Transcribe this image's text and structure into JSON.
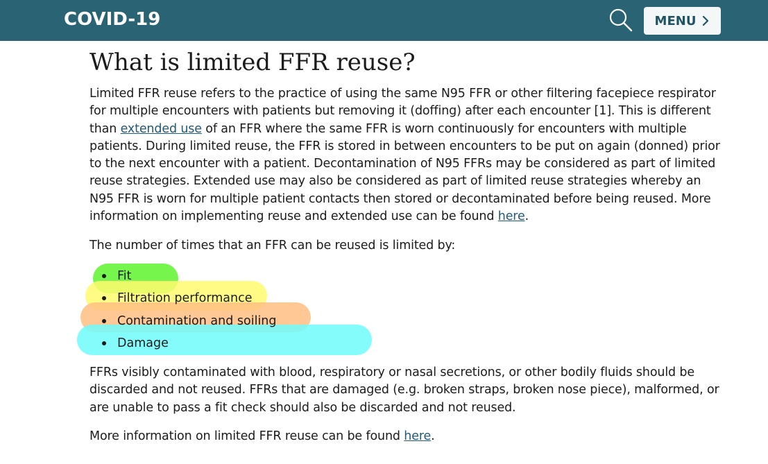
{
  "header": {
    "brand": "COVID-19",
    "menu_label": "MENU",
    "search_icon": "search-icon",
    "menu_icon": "chevron-right-icon",
    "bar_color": "#2a6474"
  },
  "main": {
    "title": "What is limited FFR reuse?",
    "intro": {
      "t1": "Limited FFR reuse refers to the practice of using the same N95 FFR or other filtering facepiece respirator for multiple encounters with patients but removing it (doffing) after each encounter [1]. This is different than ",
      "link1": "extended use",
      "t2": " of an FFR where the same FFR is worn continuously for encounters with multiple patients. During limited reuse, the FFR is stored in between encounters to be put on again (donned) prior to the next encounter with a patient. Decontamination of N95 FFRs may be considered as part of limited reuse strategies. Extended use may also be considered as part of limited reuse strategies whereby an N95 FFR is worn for multiple patient contacts then stored or decontaminated before being reused. More information on implementing reuse and extended use can be found ",
      "link2": "here",
      "t3": "."
    },
    "limits_intro": "The number of times that an FFR can be reused is limited by:",
    "limits": [
      {
        "label": "Fit",
        "highlight": "#67f538"
      },
      {
        "label": "Filtration performance",
        "highlight": "#fffa6e"
      },
      {
        "label": "Contamination and soiling",
        "highlight": "#ffbe82"
      },
      {
        "label": "Damage",
        "highlight": "#6efcfc"
      }
    ],
    "discard_text": "FFRs visibly contaminated with blood, respiratory or nasal secretions, or other bodily fluids should be discarded and not reused. FFRs that are damaged (e.g. broken straps, broken nose piece), malformed, or are unable to pass a fit check should also be discarded and not reused.",
    "more_info": {
      "t1": "More information on limited FFR reuse can be found ",
      "link": "here",
      "t2": "."
    }
  }
}
